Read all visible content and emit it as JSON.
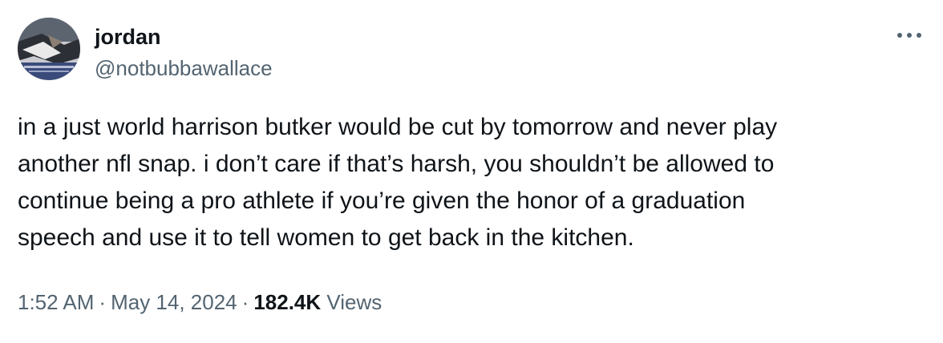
{
  "author": {
    "display_name": "jordan",
    "handle": "@notbubbawallace",
    "avatar_icon": "user-avatar-icon"
  },
  "actions": {
    "more_icon": "more-horizontal-icon"
  },
  "tweet": {
    "text": "in a just world harrison butker would be cut by tomorrow and never play\nanother nfl snap. i don’t care if that’s harsh, you shouldn’t be allowed to\ncontinue being a pro athlete if you’re given the honor of a graduation\nspeech and use it to tell women to get back in the kitchen."
  },
  "meta": {
    "time": "1:52 AM",
    "separator": "·",
    "date": "May 14, 2024",
    "views_count": "182.4K",
    "views_label": "Views"
  },
  "colors": {
    "primary_text": "#0f1419",
    "secondary_text": "#536471",
    "background": "#ffffff"
  }
}
